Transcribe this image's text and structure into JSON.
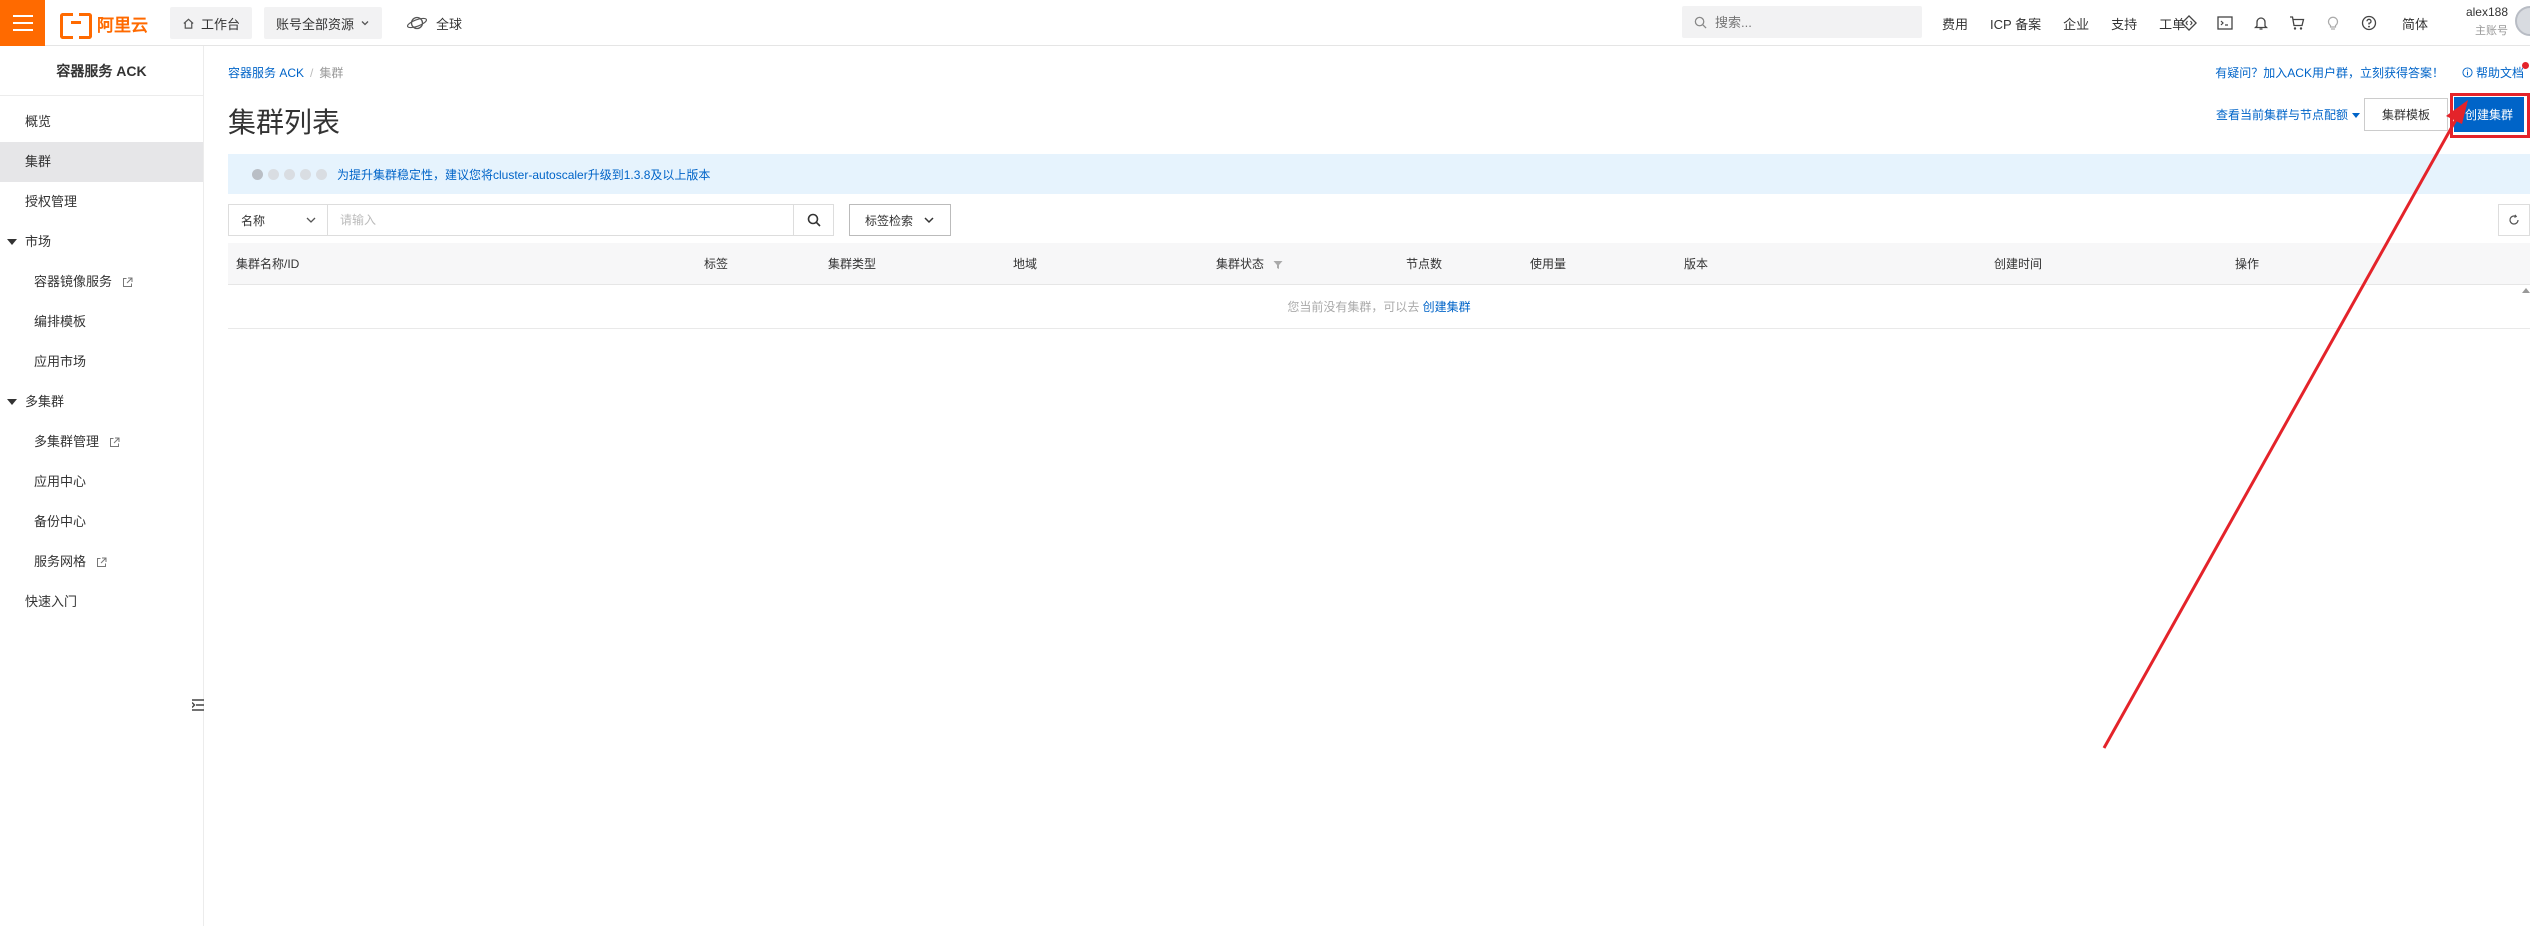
{
  "topbar": {
    "workbench_label": "工作台",
    "account_scope_label": "账号全部资源",
    "region_label": "全球",
    "search_placeholder": "搜索...",
    "links": [
      "费用",
      "ICP 备案",
      "企业",
      "支持",
      "工单"
    ],
    "icons": [
      "code-icon",
      "terminal-icon",
      "bell-icon",
      "cart-icon",
      "lightbulb-icon",
      "help-icon"
    ],
    "language": "简体",
    "username": "alex188",
    "account_role": "主账号",
    "brand_color": "#ff6a00"
  },
  "sidebar": {
    "title": "容器服务 ACK",
    "items": [
      {
        "label": "概览"
      },
      {
        "label": "集群",
        "active": true
      },
      {
        "label": "授权管理"
      }
    ],
    "group_market": {
      "label": "市场",
      "items": [
        {
          "label": "容器镜像服务",
          "external": true
        },
        {
          "label": "编排模板"
        },
        {
          "label": "应用市场"
        }
      ]
    },
    "group_multicluster": {
      "label": "多集群",
      "items": [
        {
          "label": "多集群管理",
          "external": true
        },
        {
          "label": "应用中心"
        },
        {
          "label": "备份中心"
        },
        {
          "label": "服务网格",
          "external": true
        }
      ]
    },
    "quick_start": "快速入门"
  },
  "main": {
    "breadcrumb": {
      "root": "容器服务 ACK",
      "current": "集群"
    },
    "help_text": "有疑问？加入ACK用户群，立刻获得答案！",
    "help_docs": "帮助文档",
    "page_title": "集群列表",
    "quota_link": "查看当前集群与节点配额",
    "template_button": "集群模板",
    "create_button": "创建集群",
    "banner_text": "为提升集群稳定性，建议您将cluster-autoscaler升级到1.3.8及以上版本",
    "filter": {
      "select_value": "名称",
      "search_placeholder": "请输入",
      "tag_filter_label": "标签检索"
    },
    "table": {
      "columns": [
        "集群名称/ID",
        "标签",
        "集群类型",
        "地域",
        "集群状态",
        "节点数",
        "使用量",
        "版本",
        "创建时间",
        "操作"
      ],
      "empty_text": "您当前没有集群，可以去",
      "empty_link": "创建集群"
    },
    "accent_color": "#0064c8",
    "annotation_color": "#e4232a"
  }
}
